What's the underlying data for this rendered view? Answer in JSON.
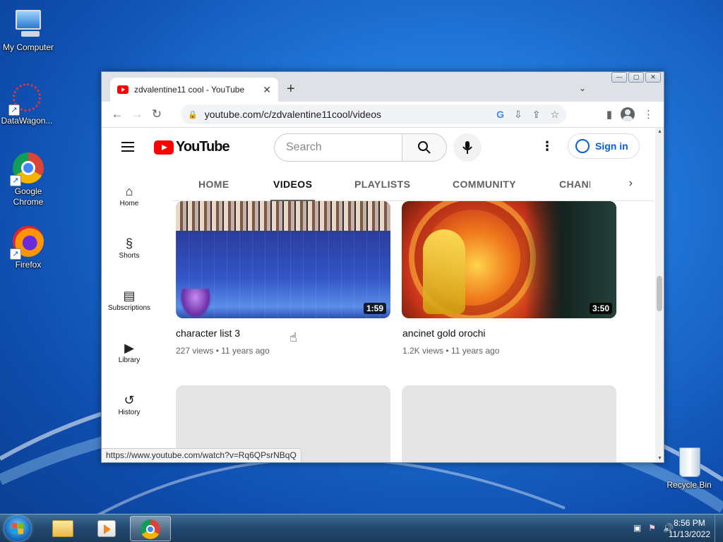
{
  "desktop": {
    "icons": [
      {
        "label": "My Computer"
      },
      {
        "label": "DataWagon..."
      },
      {
        "label": "Google Chrome"
      },
      {
        "label": "Firefox"
      },
      {
        "label": "Recycle Bin"
      }
    ]
  },
  "browser": {
    "tab_title": "zdvalentine11 cool - YouTube",
    "url": "youtube.com/c/zdvalentine11cool/videos",
    "status_url": "https://www.youtube.com/watch?v=Rq6QPsrNBqQ"
  },
  "youtube": {
    "logo_text": "YouTube",
    "search_placeholder": "Search",
    "signin_label": "Sign in",
    "channel_tabs": [
      {
        "label": "HOME"
      },
      {
        "label": "VIDEOS"
      },
      {
        "label": "PLAYLISTS"
      },
      {
        "label": "COMMUNITY"
      },
      {
        "label": "CHANI"
      }
    ],
    "active_tab": "VIDEOS",
    "sidebar": [
      {
        "label": "Home",
        "icon": "home-icon"
      },
      {
        "label": "Shorts",
        "icon": "shorts-icon"
      },
      {
        "label": "Subscriptions",
        "icon": "subscriptions-icon"
      },
      {
        "label": "Library",
        "icon": "library-icon"
      },
      {
        "label": "History",
        "icon": "history-icon"
      }
    ],
    "videos": [
      {
        "title": "character list 3",
        "views": "227 views",
        "age": "11 years ago",
        "duration": "1:59"
      },
      {
        "title": "ancinet gold orochi",
        "views": "1.2K views",
        "age": "11 years ago",
        "duration": "3:50"
      }
    ]
  },
  "taskbar": {
    "time": "8:56 PM",
    "date": "11/13/2022"
  }
}
